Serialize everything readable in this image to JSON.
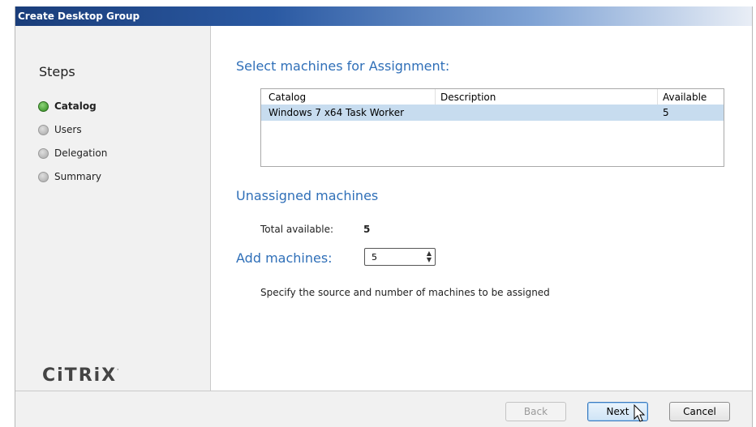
{
  "window": {
    "title": "Create Desktop Group"
  },
  "sidebar": {
    "title": "Steps",
    "steps": [
      {
        "label": "Catalog",
        "state": "active"
      },
      {
        "label": "Users",
        "state": "inactive"
      },
      {
        "label": "Delegation",
        "state": "inactive"
      },
      {
        "label": "Summary",
        "state": "inactive"
      }
    ],
    "logo_text": "CiTRiX",
    "logo_mark": "·"
  },
  "main": {
    "select_heading": "Select machines for Assignment:",
    "table": {
      "columns": [
        "Catalog",
        "Description",
        "Available"
      ],
      "rows": [
        {
          "catalog": "Windows 7 x64 Task Worker",
          "description": "",
          "available": "5"
        }
      ]
    },
    "unassigned_heading": "Unassigned machines",
    "total_available_label": "Total available:",
    "total_available_value": "5",
    "add_machines_label": "Add machines:",
    "add_machines_value": "5",
    "hint": "Specify the source and number of machines to be assigned"
  },
  "footer": {
    "back_label": "Back",
    "next_label": "Next",
    "cancel_label": "Cancel"
  },
  "colors": {
    "accent": "#2f6fb8",
    "selected_row": "#c7dcef",
    "active_step": "#3a9a27"
  }
}
